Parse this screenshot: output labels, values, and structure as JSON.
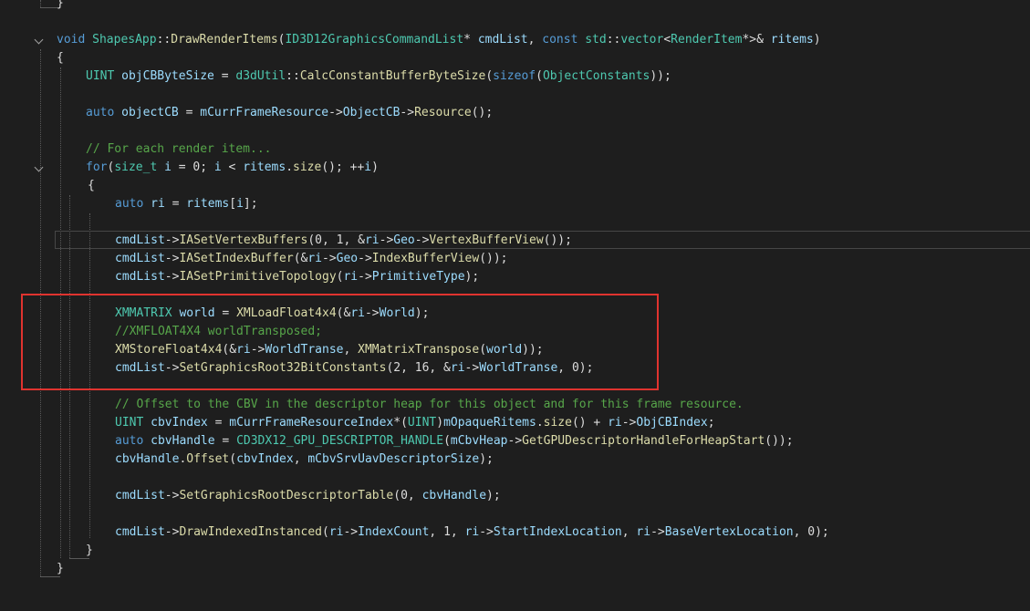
{
  "editor": {
    "language": "cpp",
    "lines": [
      {
        "tokens": [
          {
            "t": "}",
            "c": "pl"
          }
        ]
      },
      {
        "tokens": []
      },
      {
        "fold": true,
        "tokens": [
          {
            "t": "void ",
            "c": "kw"
          },
          {
            "t": "ShapesApp",
            "c": "ty"
          },
          {
            "t": "::",
            "c": "pl"
          },
          {
            "t": "DrawRenderItems",
            "c": "fn"
          },
          {
            "t": "(",
            "c": "pl"
          },
          {
            "t": "ID3D12GraphicsCommandList",
            "c": "ty"
          },
          {
            "t": "* ",
            "c": "pl"
          },
          {
            "t": "cmdList",
            "c": "va"
          },
          {
            "t": ", ",
            "c": "pl"
          },
          {
            "t": "const ",
            "c": "kw"
          },
          {
            "t": "std",
            "c": "ty"
          },
          {
            "t": "::",
            "c": "pl"
          },
          {
            "t": "vector",
            "c": "ty"
          },
          {
            "t": "<",
            "c": "pl"
          },
          {
            "t": "RenderItem",
            "c": "ty"
          },
          {
            "t": "*>& ",
            "c": "pl"
          },
          {
            "t": "ritems",
            "c": "va"
          },
          {
            "t": ")",
            "c": "pl"
          }
        ]
      },
      {
        "tokens": [
          {
            "t": "{",
            "c": "pl"
          }
        ]
      },
      {
        "tokens": [
          {
            "t": "UINT ",
            "c": "ty"
          },
          {
            "t": "objCBByteSize",
            "c": "va"
          },
          {
            "t": " = ",
            "c": "pl"
          },
          {
            "t": "d3dUtil",
            "c": "ty"
          },
          {
            "t": "::",
            "c": "pl"
          },
          {
            "t": "CalcConstantBufferByteSize",
            "c": "fn"
          },
          {
            "t": "(",
            "c": "pl"
          },
          {
            "t": "sizeof",
            "c": "kw"
          },
          {
            "t": "(",
            "c": "pl"
          },
          {
            "t": "ObjectConstants",
            "c": "ty"
          },
          {
            "t": "));",
            "c": "pl"
          }
        ]
      },
      {
        "tokens": []
      },
      {
        "tokens": [
          {
            "t": "auto ",
            "c": "kw"
          },
          {
            "t": "objectCB",
            "c": "va"
          },
          {
            "t": " = ",
            "c": "pl"
          },
          {
            "t": "mCurrFrameResource",
            "c": "va"
          },
          {
            "t": "->",
            "c": "pl"
          },
          {
            "t": "ObjectCB",
            "c": "va"
          },
          {
            "t": "->",
            "c": "pl"
          },
          {
            "t": "Resource",
            "c": "fn"
          },
          {
            "t": "();",
            "c": "pl"
          }
        ]
      },
      {
        "tokens": []
      },
      {
        "tokens": [
          {
            "t": "// For each render item...",
            "c": "cm"
          }
        ]
      },
      {
        "fold": true,
        "tokens": [
          {
            "t": "for",
            "c": "kw"
          },
          {
            "t": "(",
            "c": "pl"
          },
          {
            "t": "size_t ",
            "c": "ty"
          },
          {
            "t": "i",
            "c": "va"
          },
          {
            "t": " = 0; ",
            "c": "pl"
          },
          {
            "t": "i",
            "c": "va"
          },
          {
            "t": " < ",
            "c": "pl"
          },
          {
            "t": "ritems",
            "c": "va"
          },
          {
            "t": ".",
            "c": "pl"
          },
          {
            "t": "size",
            "c": "fn"
          },
          {
            "t": "(); ++",
            "c": "pl"
          },
          {
            "t": "i",
            "c": "va"
          },
          {
            "t": ")",
            "c": "pl"
          }
        ]
      },
      {
        "tokens": [
          {
            "t": "{",
            "c": "pl"
          }
        ]
      },
      {
        "tokens": [
          {
            "t": "auto ",
            "c": "kw"
          },
          {
            "t": "ri",
            "c": "va"
          },
          {
            "t": " = ",
            "c": "pl"
          },
          {
            "t": "ritems",
            "c": "va"
          },
          {
            "t": "[",
            "c": "pl"
          },
          {
            "t": "i",
            "c": "va"
          },
          {
            "t": "];",
            "c": "pl"
          }
        ]
      },
      {
        "tokens": []
      },
      {
        "tokens": [
          {
            "t": "cmdList",
            "c": "va"
          },
          {
            "t": "->",
            "c": "pl"
          },
          {
            "t": "IASetVertexBuffers",
            "c": "fn"
          },
          {
            "t": "(0, 1, &",
            "c": "pl"
          },
          {
            "t": "ri",
            "c": "va"
          },
          {
            "t": "->",
            "c": "pl"
          },
          {
            "t": "Geo",
            "c": "va"
          },
          {
            "t": "->",
            "c": "pl"
          },
          {
            "t": "VertexBufferView",
            "c": "fn"
          },
          {
            "t": "());",
            "c": "pl"
          }
        ]
      },
      {
        "tokens": [
          {
            "t": "cmdList",
            "c": "va"
          },
          {
            "t": "->",
            "c": "pl"
          },
          {
            "t": "IASetIndexBuffer",
            "c": "fn"
          },
          {
            "t": "(&",
            "c": "pl"
          },
          {
            "t": "ri",
            "c": "va"
          },
          {
            "t": "->",
            "c": "pl"
          },
          {
            "t": "Geo",
            "c": "va"
          },
          {
            "t": "->",
            "c": "pl"
          },
          {
            "t": "IndexBufferView",
            "c": "fn"
          },
          {
            "t": "());",
            "c": "pl"
          }
        ]
      },
      {
        "tokens": [
          {
            "t": "cmdList",
            "c": "va"
          },
          {
            "t": "->",
            "c": "pl"
          },
          {
            "t": "IASetPrimitiveTopology",
            "c": "fn"
          },
          {
            "t": "(",
            "c": "pl"
          },
          {
            "t": "ri",
            "c": "va"
          },
          {
            "t": "->",
            "c": "pl"
          },
          {
            "t": "PrimitiveType",
            "c": "va"
          },
          {
            "t": ");",
            "c": "pl"
          }
        ]
      },
      {
        "tokens": []
      },
      {
        "tokens": [
          {
            "t": "XMMATRIX ",
            "c": "ty"
          },
          {
            "t": "world",
            "c": "va"
          },
          {
            "t": " = ",
            "c": "pl"
          },
          {
            "t": "XMLoadFloat4x4",
            "c": "fn"
          },
          {
            "t": "(&",
            "c": "pl"
          },
          {
            "t": "ri",
            "c": "va"
          },
          {
            "t": "->",
            "c": "pl"
          },
          {
            "t": "World",
            "c": "va"
          },
          {
            "t": ");",
            "c": "pl"
          }
        ]
      },
      {
        "tokens": [
          {
            "t": "//XMFLOAT4X4 worldTransposed;",
            "c": "cm"
          }
        ]
      },
      {
        "tokens": [
          {
            "t": "XMStoreFloat4x4",
            "c": "fn"
          },
          {
            "t": "(&",
            "c": "pl"
          },
          {
            "t": "ri",
            "c": "va"
          },
          {
            "t": "->",
            "c": "pl"
          },
          {
            "t": "WorldTranse",
            "c": "va"
          },
          {
            "t": ", ",
            "c": "pl"
          },
          {
            "t": "XMMatrixTranspose",
            "c": "fn"
          },
          {
            "t": "(",
            "c": "pl"
          },
          {
            "t": "world",
            "c": "va"
          },
          {
            "t": "));",
            "c": "pl"
          }
        ]
      },
      {
        "tokens": [
          {
            "t": "cmdList",
            "c": "va"
          },
          {
            "t": "->",
            "c": "pl"
          },
          {
            "t": "SetGraphicsRoot32BitConstants",
            "c": "fn"
          },
          {
            "t": "(2, 16, &",
            "c": "pl"
          },
          {
            "t": "ri",
            "c": "va"
          },
          {
            "t": "->",
            "c": "pl"
          },
          {
            "t": "WorldTranse",
            "c": "va"
          },
          {
            "t": ", 0);",
            "c": "pl"
          }
        ]
      },
      {
        "tokens": []
      },
      {
        "tokens": [
          {
            "t": "// Offset to the CBV in the descriptor heap for this object and for this frame resource.",
            "c": "cm"
          }
        ]
      },
      {
        "tokens": [
          {
            "t": "UINT ",
            "c": "ty"
          },
          {
            "t": "cbvIndex",
            "c": "va"
          },
          {
            "t": " = ",
            "c": "pl"
          },
          {
            "t": "mCurrFrameResourceIndex",
            "c": "va"
          },
          {
            "t": "*(",
            "c": "pl"
          },
          {
            "t": "UINT",
            "c": "ty"
          },
          {
            "t": ")",
            "c": "pl"
          },
          {
            "t": "mOpaqueRitems",
            "c": "va"
          },
          {
            "t": ".",
            "c": "pl"
          },
          {
            "t": "size",
            "c": "fn"
          },
          {
            "t": "() + ",
            "c": "pl"
          },
          {
            "t": "ri",
            "c": "va"
          },
          {
            "t": "->",
            "c": "pl"
          },
          {
            "t": "ObjCBIndex",
            "c": "va"
          },
          {
            "t": ";",
            "c": "pl"
          }
        ]
      },
      {
        "tokens": [
          {
            "t": "auto ",
            "c": "kw"
          },
          {
            "t": "cbvHandle",
            "c": "va"
          },
          {
            "t": " = ",
            "c": "pl"
          },
          {
            "t": "CD3DX12_GPU_DESCRIPTOR_HANDLE",
            "c": "ty"
          },
          {
            "t": "(",
            "c": "pl"
          },
          {
            "t": "mCbvHeap",
            "c": "va"
          },
          {
            "t": "->",
            "c": "pl"
          },
          {
            "t": "GetGPUDescriptorHandleForHeapStart",
            "c": "fn"
          },
          {
            "t": "());",
            "c": "pl"
          }
        ]
      },
      {
        "tokens": [
          {
            "t": "cbvHandle",
            "c": "va"
          },
          {
            "t": ".",
            "c": "pl"
          },
          {
            "t": "Offset",
            "c": "fn"
          },
          {
            "t": "(",
            "c": "pl"
          },
          {
            "t": "cbvIndex",
            "c": "va"
          },
          {
            "t": ", ",
            "c": "pl"
          },
          {
            "t": "mCbvSrvUavDescriptorSize",
            "c": "va"
          },
          {
            "t": ");",
            "c": "pl"
          }
        ]
      },
      {
        "tokens": []
      },
      {
        "tokens": [
          {
            "t": "cmdList",
            "c": "va"
          },
          {
            "t": "->",
            "c": "pl"
          },
          {
            "t": "SetGraphicsRootDescriptorTable",
            "c": "fn"
          },
          {
            "t": "(0, ",
            "c": "pl"
          },
          {
            "t": "cbvHandle",
            "c": "va"
          },
          {
            "t": ");",
            "c": "pl"
          }
        ]
      },
      {
        "tokens": []
      },
      {
        "tokens": [
          {
            "t": "cmdList",
            "c": "va"
          },
          {
            "t": "->",
            "c": "pl"
          },
          {
            "t": "DrawIndexedInstanced",
            "c": "fn"
          },
          {
            "t": "(",
            "c": "pl"
          },
          {
            "t": "ri",
            "c": "va"
          },
          {
            "t": "->",
            "c": "pl"
          },
          {
            "t": "IndexCount",
            "c": "va"
          },
          {
            "t": ", 1, ",
            "c": "pl"
          },
          {
            "t": "ri",
            "c": "va"
          },
          {
            "t": "->",
            "c": "pl"
          },
          {
            "t": "StartIndexLocation",
            "c": "va"
          },
          {
            "t": ", ",
            "c": "pl"
          },
          {
            "t": "ri",
            "c": "va"
          },
          {
            "t": "->",
            "c": "pl"
          },
          {
            "t": "BaseVertexLocation",
            "c": "va"
          },
          {
            "t": ", 0);",
            "c": "pl"
          }
        ]
      },
      {
        "tokens": [
          {
            "t": "}",
            "c": "pl"
          }
        ]
      },
      {
        "tokens": [
          {
            "t": "}",
            "c": "pl"
          }
        ]
      }
    ]
  },
  "colors": {
    "background": "#1e1e1e",
    "keyword": "#569cd6",
    "type": "#4ec9b0",
    "function": "#dcdcaa",
    "comment": "#57a64a",
    "variable": "#9cdcfe",
    "plain": "#dcdcdc",
    "annotation_box": "#e0332f"
  },
  "annotation": {
    "label": "highlight-box",
    "color": "#e0332f"
  }
}
